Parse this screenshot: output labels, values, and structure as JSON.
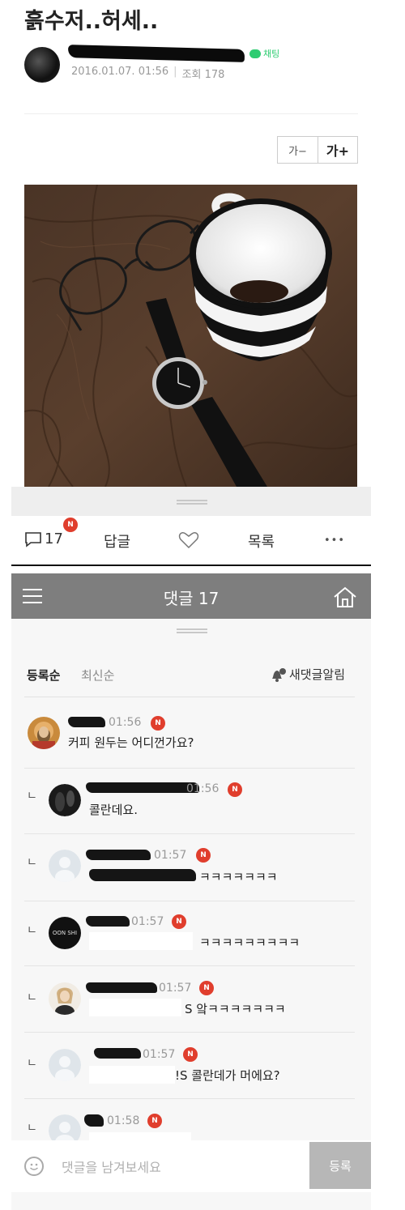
{
  "post": {
    "title": "흙수저..허세..",
    "chat_label": "채팅",
    "date": "2016.01.07. 01:56",
    "views_label": "조회 178"
  },
  "font_controls": {
    "decrease": "가−",
    "increase": "가+"
  },
  "actions": {
    "comment_count": "17",
    "new_badge": "N",
    "reply": "답글",
    "list": "목록",
    "more": "•••"
  },
  "comments_panel": {
    "title": "댓글 17",
    "sort_registered": "등록순",
    "sort_latest": "최신순",
    "notify": "새댓글알림",
    "input_placeholder": "댓글을 남겨보세요",
    "submit": "등록"
  },
  "comments": [
    {
      "time": "01:56",
      "text": "커피 원두는 어디껀가요?",
      "badge": "N"
    },
    {
      "reply_mark": "ㄴ",
      "time": "01:56",
      "text": "콜란데요.",
      "badge": "N"
    },
    {
      "reply_mark": "ㄴ",
      "time": "01:57",
      "text": "ㅋㅋㅋㅋㅋㅋㅋ",
      "badge": "N"
    },
    {
      "reply_mark": "ㄴ",
      "time": "01:57",
      "text": "ㅋㅋㅋㅋㅋㅋㅋㅋㅋ",
      "badge": "N",
      "avatar_text": "OON SHI"
    },
    {
      "reply_mark": "ㄴ",
      "time": "01:57",
      "text": "S 앜ㅋㅋㅋㅋㅋㅋㅋ",
      "badge": "N"
    },
    {
      "reply_mark": "ㄴ",
      "time": "01:57",
      "text": "!S 콜란데가 머에요?",
      "badge": "N"
    },
    {
      "reply_mark": "ㄴ",
      "time": "01:58",
      "badge": "N"
    }
  ]
}
